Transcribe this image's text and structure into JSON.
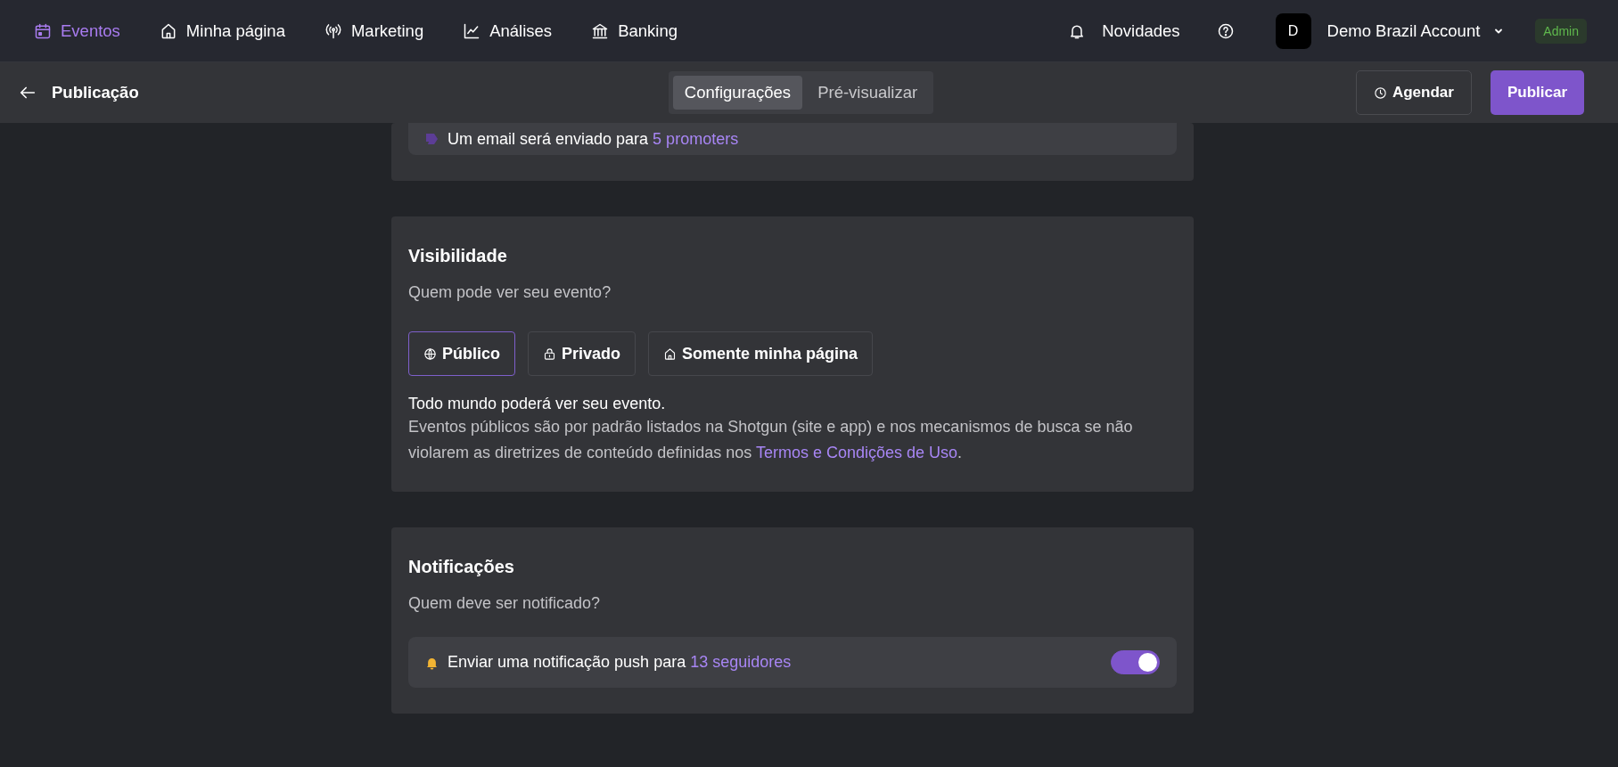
{
  "nav": {
    "items": [
      {
        "label": "Eventos",
        "selected": true
      },
      {
        "label": "Minha página",
        "selected": false
      },
      {
        "label": "Marketing",
        "selected": false
      },
      {
        "label": "Análises",
        "selected": false
      },
      {
        "label": "Banking",
        "selected": false
      }
    ],
    "news": "Novidades",
    "account": {
      "initial": "D",
      "name": "Demo Brazil Account",
      "role": "Admin"
    }
  },
  "subheader": {
    "title": "Publicação",
    "tabs": [
      {
        "label": "Configurações",
        "selected": true
      },
      {
        "label": "Pré-visualizar",
        "selected": false
      }
    ],
    "schedule": "Agendar",
    "publish": "Publicar"
  },
  "email": {
    "text": "Um email será enviado para",
    "link": "5 promoters"
  },
  "visibility": {
    "title": "Visibilidade",
    "subtitle": "Quem pode ver seu evento?",
    "options": [
      {
        "label": "Público",
        "selected": true
      },
      {
        "label": "Privado",
        "selected": false
      },
      {
        "label": "Somente minha página",
        "selected": false
      }
    ],
    "summary": "Todo mundo poderá ver seu evento.",
    "description": "Eventos públicos são por padrão listados na Shotgun (site e app) e nos mecanismos de busca se não violarem as diretrizes de conteúdo definidas nos",
    "description_link": "Termos e Condições de Uso",
    "description_end": "."
  },
  "notifications": {
    "title": "Notificações",
    "subtitle": "Quem deve ser notificado?",
    "push": {
      "text": "Enviar uma notificação push para",
      "link": "13 seguidores",
      "on": true
    }
  }
}
